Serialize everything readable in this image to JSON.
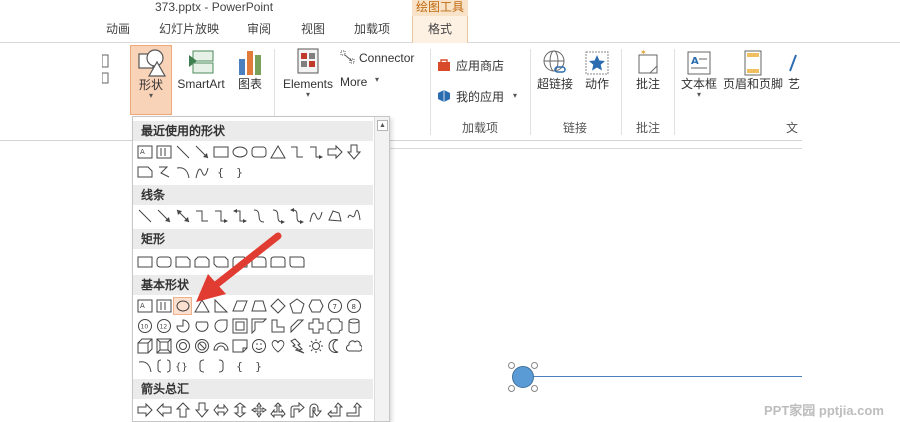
{
  "window": {
    "title": "373.pptx - PowerPoint"
  },
  "context_group": {
    "label": "绘图工具"
  },
  "tabs": [
    {
      "label": "动画"
    },
    {
      "label": "幻灯片放映"
    },
    {
      "label": "审阅"
    },
    {
      "label": "视图"
    },
    {
      "label": "加载项"
    },
    {
      "label": "格式"
    }
  ],
  "ribbon": {
    "shapes": {
      "label": "形状"
    },
    "smartart": {
      "label": "SmartArt"
    },
    "chart": {
      "label": "图表"
    },
    "elements": {
      "label": "Elements"
    },
    "connector": {
      "label": "Connector"
    },
    "more": {
      "label": "More"
    },
    "store": {
      "label": "应用商店"
    },
    "my_apps": {
      "label": "我的应用"
    },
    "hyperlink": {
      "label": "超链接"
    },
    "action": {
      "label": "动作"
    },
    "comment": {
      "label": "批注"
    },
    "textbox": {
      "label": "文本框"
    },
    "header_footer": {
      "label": "页眉和页脚"
    },
    "wordart": {
      "label": "艺"
    },
    "groups": {
      "addins": "加载项",
      "links": "链接",
      "comments": "批注",
      "text": "文"
    }
  },
  "shapes_dropdown": {
    "sections": [
      {
        "title": "最近使用的形状"
      },
      {
        "title": "线条"
      },
      {
        "title": "矩形"
      },
      {
        "title": "基本形状"
      },
      {
        "title": "箭头总汇"
      }
    ]
  },
  "watermark": {
    "text": "PPT家园 pptjia.com"
  }
}
